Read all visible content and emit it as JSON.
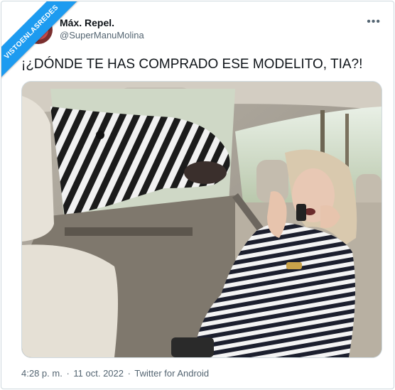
{
  "watermark": "VISTOENLASREDES",
  "author": {
    "display_name": "Máx. Repel.",
    "handle": "@SuperManuMolina"
  },
  "more_label": "•••",
  "tweet": {
    "text": "¡¿DÓNDE TE HAS COMPRADO ESE MODELITO, TIA?!"
  },
  "meta": {
    "time": "4:28 p. m.",
    "sep1": "·",
    "date": "11 oct. 2022",
    "sep2": "·",
    "client": "Twitter for Android"
  },
  "colors": {
    "accent": "#1d9bf0",
    "text": "#0f1419",
    "secondary": "#536471",
    "border": "#cfd9de"
  },
  "icons": [
    "more-icon",
    "avatar-image",
    "photo-zebra-car"
  ]
}
